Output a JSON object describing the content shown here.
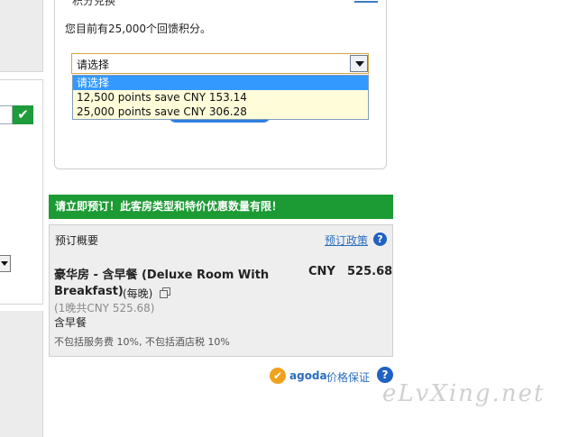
{
  "points": {
    "title_partial": "积分兑换",
    "current_points_text": "您目前有25,000个回馈积分。",
    "select_value": "请选择",
    "options": [
      {
        "label": "请选择",
        "selected": true
      },
      {
        "label": "12,500 points save CNY 153.14",
        "selected": false
      },
      {
        "label": "25,000 points save CNY 306.28",
        "selected": false
      }
    ]
  },
  "banner": {
    "text": "请立即预订！此客房类型和特价优惠数量有限！",
    "color": "#1c9a33"
  },
  "summary": {
    "title": "预订概要",
    "policy_link": "预订政策",
    "help_glyph": "?",
    "room_name_line1": "豪华房 - 含早餐 (Deluxe Room With",
    "room_name_line2": "Breakfast)",
    "per_night": "(每晚)",
    "currency": "CNY",
    "price": "525.68",
    "total_line": "(1晚共CNY 525.68)",
    "breakfast": "含早餐",
    "tax_note": "不包括服务费 10%, 不包括酒店税 10%"
  },
  "guarantee": {
    "brand": "agoda",
    "text": "价格保证",
    "check_glyph": "✔",
    "help_glyph": "?"
  },
  "left": {
    "check_glyph": "✔"
  },
  "watermark": "eLvXing.net",
  "icons": {
    "validation": "check-icon",
    "copy": "copy-icon",
    "help": "help-icon",
    "guarantee": "check-badge-icon",
    "dropdown": "chevron-down-icon"
  }
}
